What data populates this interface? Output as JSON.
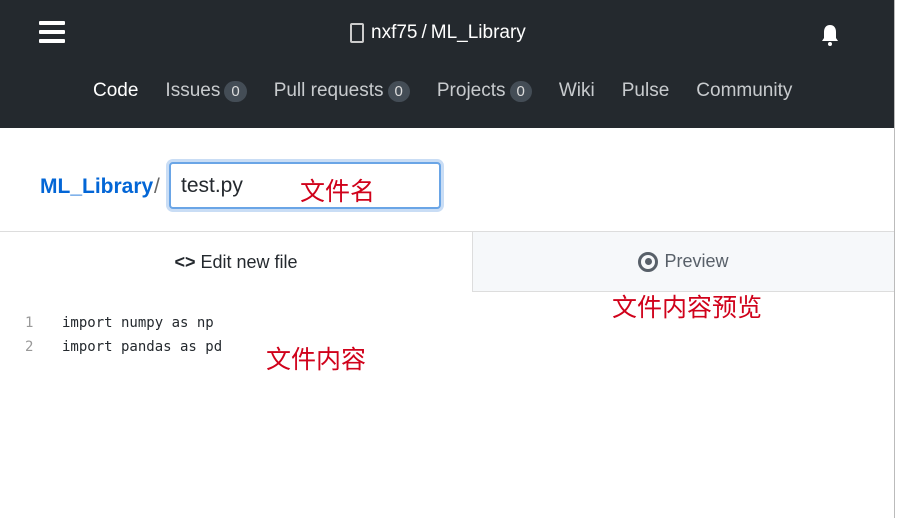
{
  "header": {
    "owner": "nxf75",
    "separator": "/",
    "repo": "ML_Library",
    "nav": [
      {
        "label": "Code",
        "active": true
      },
      {
        "label": "Issues",
        "count": "0"
      },
      {
        "label": "Pull requests",
        "count": "0"
      },
      {
        "label": "Projects",
        "count": "0"
      },
      {
        "label": "Wiki"
      },
      {
        "label": "Pulse"
      },
      {
        "label": "Community"
      }
    ]
  },
  "editor": {
    "breadcrumb": "ML_Library",
    "separator": "/",
    "filename": "test.py",
    "tabs": {
      "edit": "Edit new file",
      "preview": "Preview"
    },
    "lines": [
      {
        "n": "1",
        "code": "import numpy as np"
      },
      {
        "n": "2",
        "code": "import pandas as pd"
      }
    ]
  },
  "annotations": {
    "filename": "文件名",
    "content": "文件内容",
    "preview": "文件内容预览"
  },
  "colors": {
    "header_bg": "#24292e",
    "link": "#0366d6",
    "annotation": "#d0021b"
  }
}
